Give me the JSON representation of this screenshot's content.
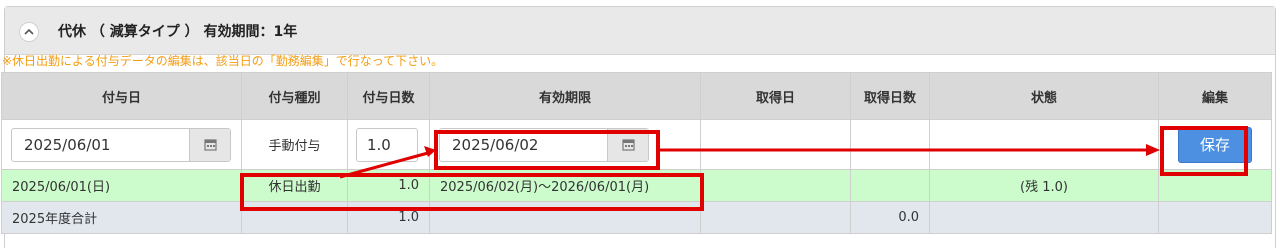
{
  "panel": {
    "title": "代休 （ 減算タイプ ） 有効期間：1年",
    "notice": "※休日出勤による付与データの編集は、該当日の「勤務編集」で行なって下さい。"
  },
  "table": {
    "headers": [
      "付与日",
      "付与種別",
      "付与日数",
      "有効期限",
      "取得日",
      "取得日数",
      "状態",
      "編集"
    ],
    "edit_row": {
      "grant_date": "2025/06/01",
      "grant_type": "手動付与",
      "grant_days": "1.0",
      "expiry_date": "2025/06/02",
      "save_label": "保存"
    },
    "green_row": {
      "grant_date": "2025/06/01(日)",
      "grant_type": "休日出勤",
      "grant_days": "1.0",
      "expiry": "2025/06/02(月)～2026/06/01(月)",
      "status": "(残 1.0)"
    },
    "total_row": {
      "label": "2025年度合計",
      "grant_days": "1.0",
      "taken_days": "0.0"
    }
  },
  "colors": {
    "highlight": "#e00000",
    "save_button": "#4d8fe0",
    "green_row": "#ccfbcc",
    "notice": "#f39c12"
  },
  "icons": [
    "chevron-up-icon",
    "calendar-icon"
  ]
}
